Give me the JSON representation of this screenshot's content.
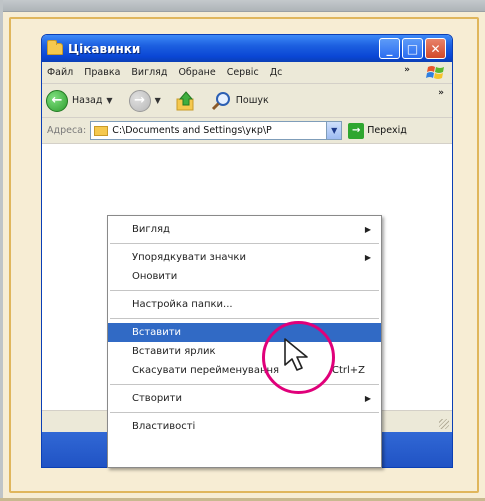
{
  "window": {
    "title": "Цікавинки",
    "controls": {
      "minimize": "_",
      "maximize": "□",
      "close": "✕"
    }
  },
  "menubar": {
    "items": [
      "Файл",
      "Правка",
      "Вигляд",
      "Обране",
      "Сервіс",
      "Дс"
    ],
    "overflow": "»"
  },
  "toolbar": {
    "back_label": "Назад",
    "search_label": "Пошук",
    "overflow": "»"
  },
  "addressbar": {
    "label": "Адреса:",
    "value": "C:\\Documents and Settings\\укр\\Р",
    "go_label": "Перехід"
  },
  "context_menu": {
    "items": [
      {
        "label": "Вигляд",
        "submenu": true
      },
      {
        "label": "Упорядкувати значки",
        "submenu": true
      },
      {
        "label": "Оновити"
      },
      {
        "label": "Настройка папки..."
      },
      {
        "label": "Вставити",
        "highlighted": true
      },
      {
        "label": "Вставити ярлик"
      },
      {
        "label": "Скасувати перейменування",
        "shortcut": "Ctrl+Z"
      },
      {
        "label": "Створити",
        "submenu": true
      },
      {
        "label": "Властивості"
      }
    ]
  },
  "icons": {
    "folder": "folder-icon",
    "back": "back-arrow-icon",
    "forward": "forward-arrow-icon",
    "up": "up-folder-icon",
    "search": "search-icon",
    "go": "go-arrow-icon",
    "windows_logo": "windows-logo-icon",
    "cursor": "mouse-cursor-icon"
  },
  "colors": {
    "titlebar": "#0a46d5",
    "highlight": "#316ac5",
    "cursor_ring": "#e0007a",
    "background": "#f7edd4"
  }
}
